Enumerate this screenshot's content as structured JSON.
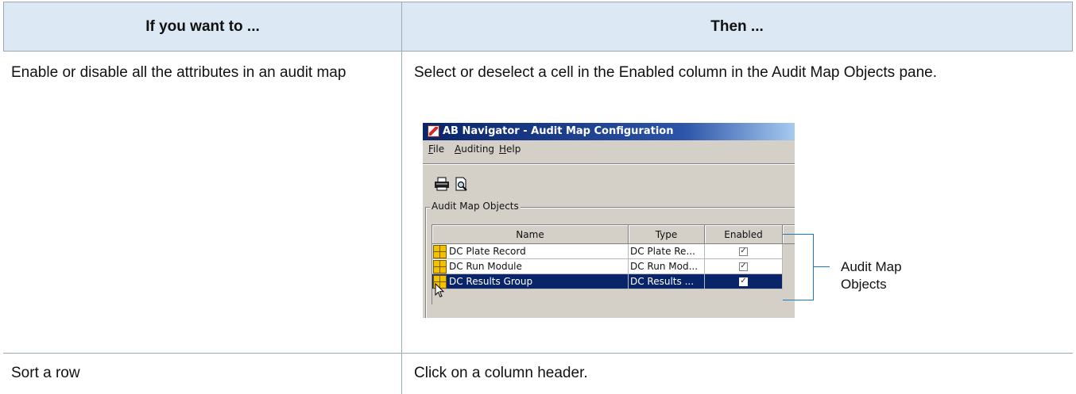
{
  "table": {
    "headers": [
      "If you want to ...",
      "Then ..."
    ],
    "rows": [
      {
        "action": "Enable or disable all the attributes in an audit map",
        "result": "Select or deselect a cell in the Enabled column in the Audit Map Objects pane."
      },
      {
        "action": "Sort a row",
        "result": "Click on a column header."
      }
    ]
  },
  "window": {
    "title": "AB Navigator - Audit Map Configuration",
    "menu": [
      {
        "key": "F",
        "rest": "ile"
      },
      {
        "key": "A",
        "rest": "uditing"
      },
      {
        "key": "H",
        "rest": "elp"
      }
    ],
    "toolbar": [
      "printer-icon",
      "print-preview-icon"
    ],
    "group_label": "Audit Map Objects",
    "grid": {
      "columns": [
        "Name",
        "Type",
        "Enabled"
      ],
      "rows": [
        {
          "name": "DC Plate Record",
          "type": "DC Plate Re...",
          "enabled": true,
          "selected": false
        },
        {
          "name": "DC Run Module",
          "type": "DC Run Mod...",
          "enabled": true,
          "selected": false
        },
        {
          "name": "DC Results Group",
          "type": "DC Results ...",
          "enabled": true,
          "selected": true
        }
      ]
    },
    "colors": {
      "title_start": "#0a246a",
      "title_end": "#a6caf0",
      "selection": "#0a246a",
      "chrome": "#d4d0c8"
    }
  },
  "callout": {
    "line1": "Audit Map",
    "line2": "Objects",
    "color": "#1b78bf"
  },
  "colors": {
    "header_bg": "#dce9f4",
    "rule": "#9aa9b6"
  }
}
